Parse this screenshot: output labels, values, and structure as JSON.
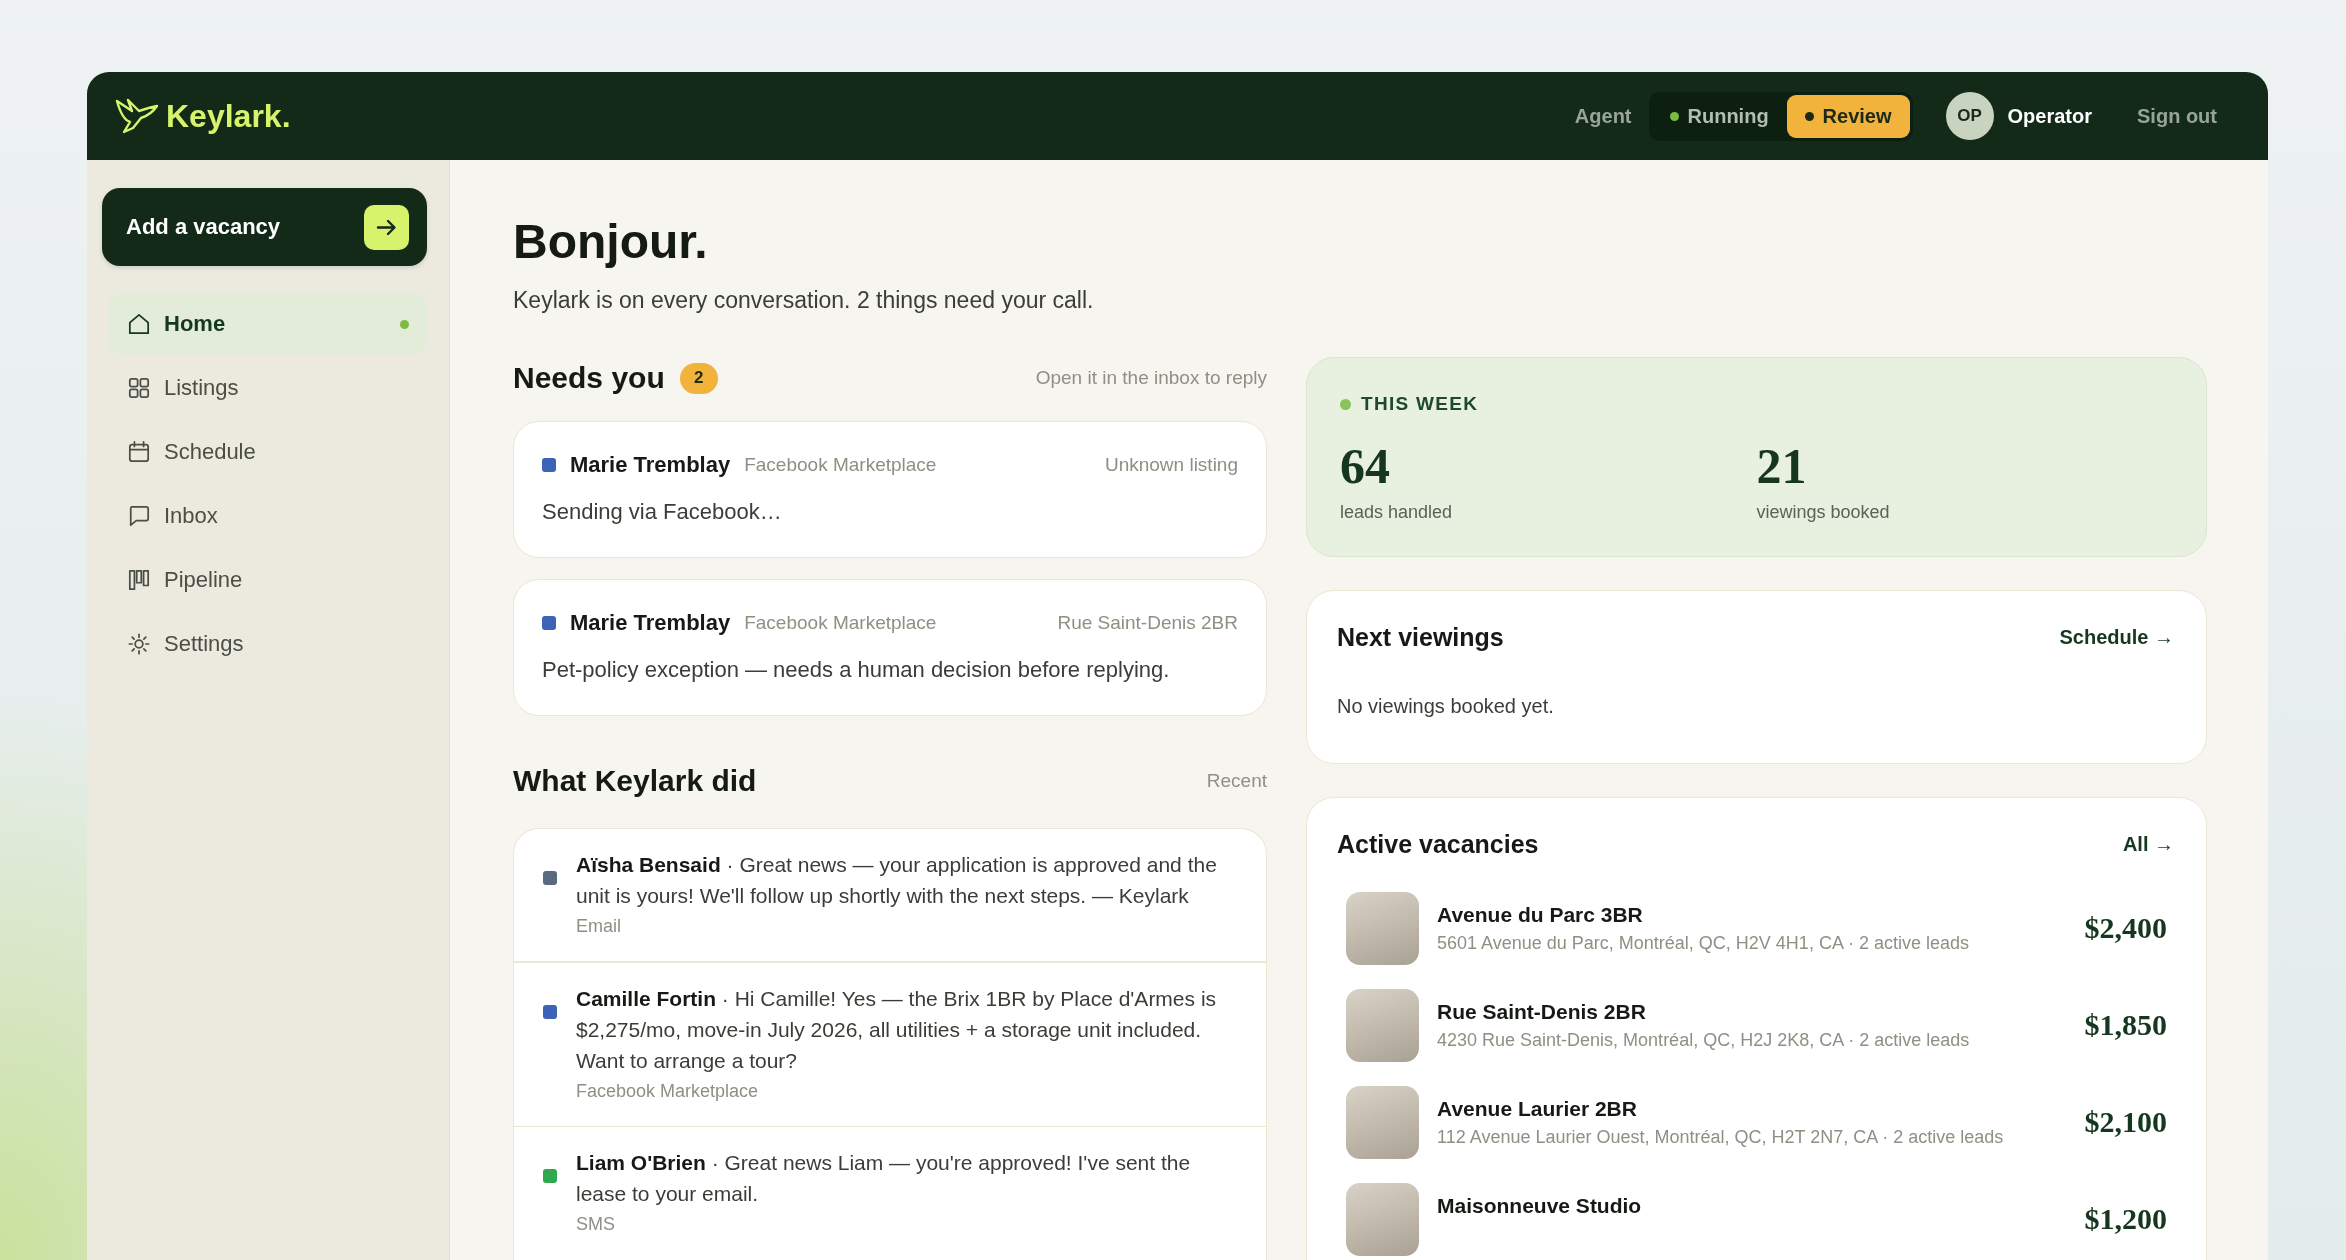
{
  "header": {
    "logo": "Keylark.",
    "agent_label": "Agent",
    "mode_toggle": [
      {
        "label": "Running",
        "selected": false,
        "color": "#7dbb42"
      },
      {
        "label": "Review",
        "selected": true,
        "color": "#1c2a14"
      }
    ],
    "user": {
      "initials": "OP",
      "name": "Operator"
    },
    "sign_out": "Sign out"
  },
  "sidebar": {
    "primary_button": "Add a vacancy",
    "items": [
      {
        "label": "Home",
        "selected": true
      },
      {
        "label": "Listings",
        "selected": false
      },
      {
        "label": "Schedule",
        "selected": false
      },
      {
        "label": "Inbox",
        "selected": false
      },
      {
        "label": "Pipeline",
        "selected": false
      },
      {
        "label": "Settings",
        "selected": false
      }
    ]
  },
  "greeting": {
    "title": "Bonjour.",
    "subtitle": "Keylark is on every conversation. 2 things need your call."
  },
  "needs_you": {
    "title": "Needs you",
    "count": "2",
    "hint": "Open it in the inbox to reply",
    "items": [
      {
        "name": "Marie Tremblay",
        "source": "Facebook Marketplace",
        "listing": "Unknown listing",
        "message": "Sending via Facebook…",
        "color": "#3d63b8"
      },
      {
        "name": "Marie Tremblay",
        "source": "Facebook Marketplace",
        "listing": "Rue Saint-Denis 2BR",
        "message": "Pet-policy exception — needs a human decision before replying.",
        "color": "#3d63b8"
      }
    ]
  },
  "activity": {
    "title": "What Keylark did",
    "filter": "Recent",
    "items": [
      {
        "text": "**Aïsha Bensaid** · Great news — your application is approved and the unit is yours! We'll follow up shortly with the next steps. — Keylark",
        "channel": "Email",
        "color": "#5b6b7f"
      },
      {
        "text": "**Camille Fortin** · Hi Camille! Yes — the Brix 1BR by Place d'Armes is $2,275/mo, move-in July 2026, all utilities + a storage unit included. Want to arrange a tour?",
        "channel": "Facebook Marketplace",
        "color": "#3d63b8"
      },
      {
        "text": "**Liam O'Brien** · Great news Liam — you're approved! I've sent the lease to your email.",
        "channel": "SMS",
        "color": "#2fa84f"
      }
    ]
  },
  "this_week": {
    "title": "THIS WEEK",
    "stats": [
      {
        "value": "64",
        "label": "leads handled"
      },
      {
        "value": "21",
        "label": "viewings booked"
      }
    ]
  },
  "next_viewings": {
    "title": "Next viewings",
    "link": "Schedule →",
    "empty": "No viewings booked yet."
  },
  "active_vacancies": {
    "title": "Active vacancies",
    "link": "All →",
    "items": [
      {
        "name": "Avenue du Parc 3BR",
        "details": "5601 Avenue du Parc, Montréal, QC, H2V 4H1, CA · 2 active leads",
        "price": "$2,400"
      },
      {
        "name": "Rue Saint-Denis 2BR",
        "details": "4230 Rue Saint-Denis, Montréal, QC, H2J 2K8, CA · 2 active leads",
        "price": "$1,850"
      },
      {
        "name": "Avenue Laurier 2BR",
        "details": "112 Avenue Laurier Ouest, Montréal, QC, H2T 2N7, CA · 2 active leads",
        "price": "$2,100"
      },
      {
        "name": "Maisonneuve Studio",
        "price": "$1,200"
      }
    ]
  }
}
